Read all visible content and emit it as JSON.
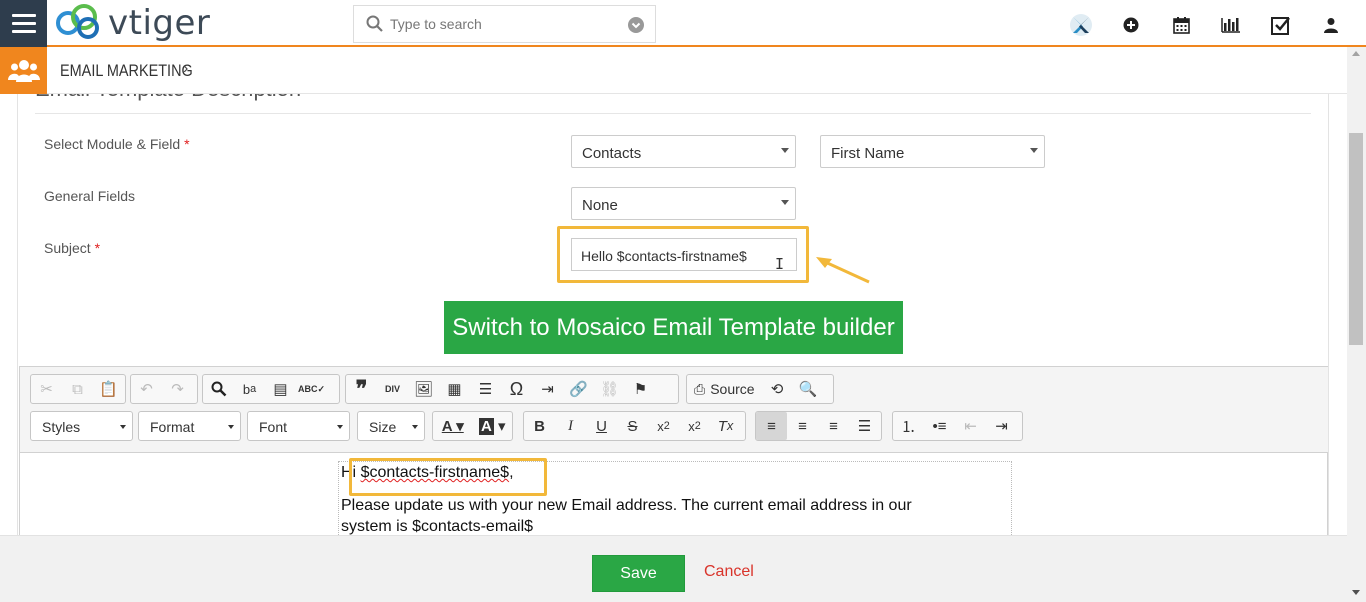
{
  "app": {
    "logo_text": "vtiger"
  },
  "search": {
    "placeholder": "Type to search"
  },
  "header_icons": [
    "app-switcher-icon",
    "add-icon",
    "calendar-icon",
    "reports-icon",
    "tasks-icon",
    "user-icon"
  ],
  "module": {
    "title": "EMAIL MARKETING",
    "chevron": "›"
  },
  "section": {
    "title": "Email Template Description"
  },
  "form": {
    "module_field_label": "Select Module & Field",
    "module_value": "Contacts",
    "field_value": "First Name",
    "general_fields_label": "General Fields",
    "general_fields_value": "None",
    "subject_label": "Subject",
    "required_mark": "*",
    "subject_value": "Hello $contacts-firstname$"
  },
  "mosaico_button": "Switch to Mosaico Email Template builder",
  "editor": {
    "source_label": "Source",
    "styles_label": "Styles",
    "format_label": "Format",
    "font_label": "Font",
    "size_label": "Size",
    "body_line1_prefix": "Hi ",
    "body_line1_var": "$contacts-firstname$",
    "body_line1_suffix": ",",
    "body_line2": "Please update us with your new Email address. The current email address in our",
    "body_line3": "system is $contacts-email$"
  },
  "footer": {
    "save_label": "Save",
    "cancel_label": "Cancel"
  },
  "colors": {
    "accent_orange": "#f0861e",
    "green": "#2aa745",
    "highlight": "#f2b83a",
    "cancel_red": "#d9342b"
  }
}
